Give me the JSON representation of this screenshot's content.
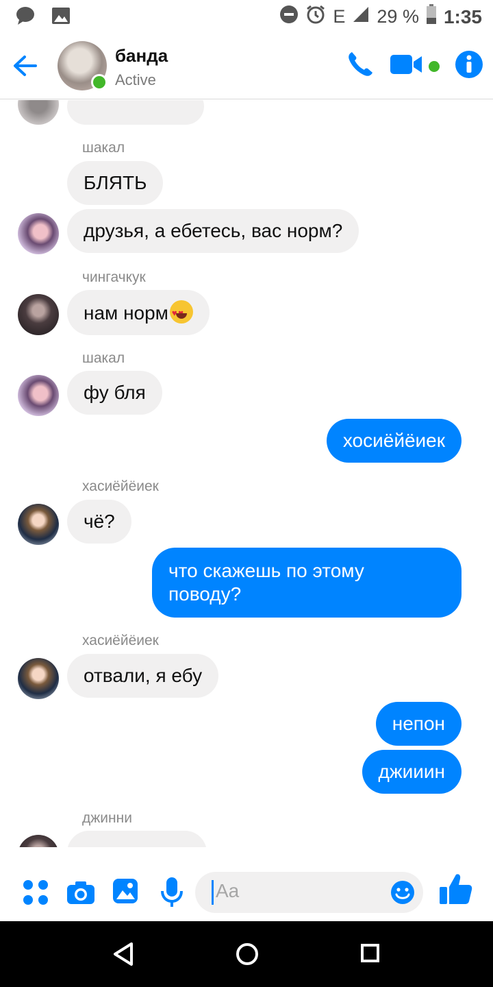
{
  "status_bar": {
    "network": "E",
    "battery": "29 %",
    "time": "1:35"
  },
  "header": {
    "title": "банда",
    "subtitle": "Active"
  },
  "messages": [
    {
      "sender": "шакал",
      "text": "БЛЯТЬ"
    },
    {
      "text": "друзья, а ебетесь, вас норм?"
    },
    {
      "sender": "чингачкук",
      "text": "нам норм"
    },
    {
      "sender": "шакал",
      "text": "фу бля"
    },
    {
      "text": "хосиёйёиек"
    },
    {
      "sender": "хасиёйёиек",
      "text": "чё?"
    },
    {
      "text": "что скажешь по этому\nповоду?"
    },
    {
      "sender": "хасиёйёиек",
      "text": "отвали, я ебу"
    },
    {
      "text": "непон"
    },
    {
      "text": "джииин"
    },
    {
      "sender": "джинни"
    }
  ],
  "composer": {
    "placeholder": "Aa"
  },
  "colors": {
    "accent": "#0084ff",
    "online": "#42b72a",
    "incoming_bubble": "#f1f0f0"
  }
}
